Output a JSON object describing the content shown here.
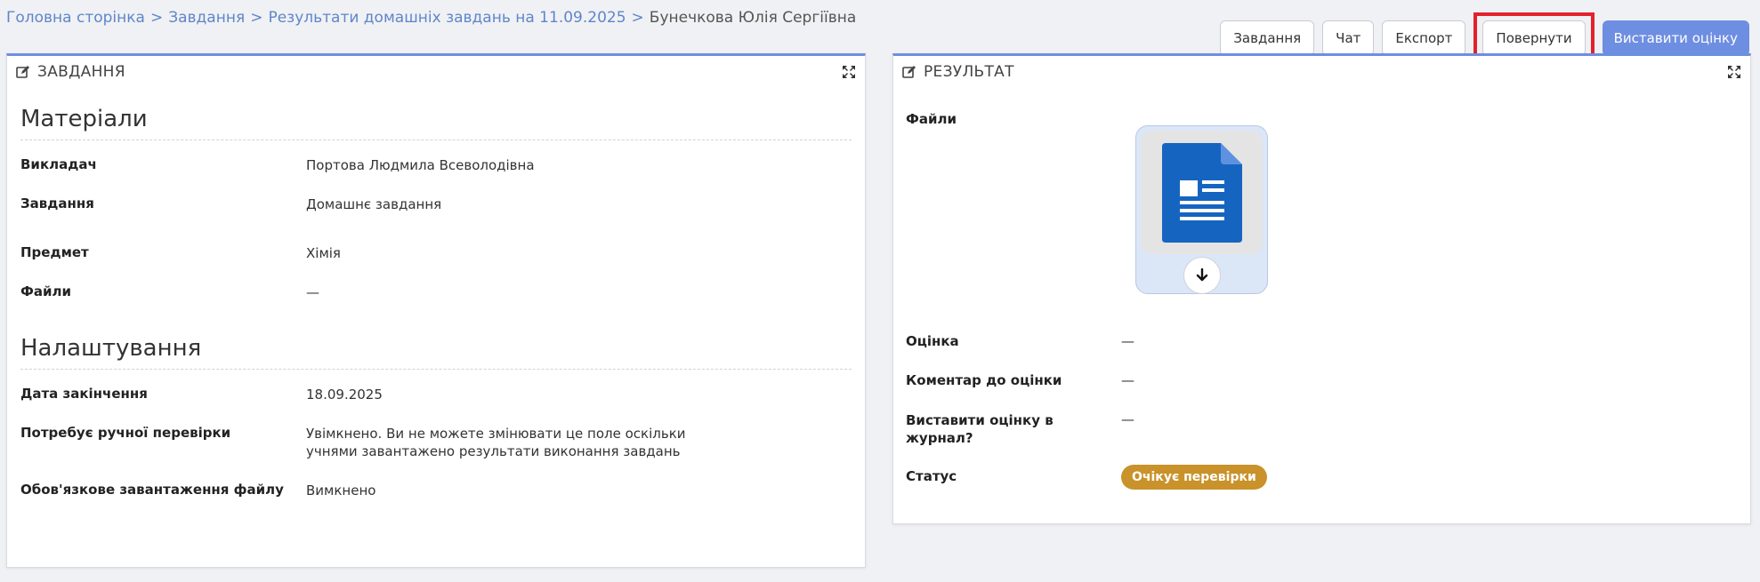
{
  "breadcrumb": {
    "items": [
      "Головна сторінка",
      "Завдання",
      "Результати домашніх завдань на 11.09.2025"
    ],
    "separator": ">",
    "current": "Бунечкова Юлія Сергіївна"
  },
  "toolbar": {
    "tasks_label": "Завдання",
    "chat_label": "Чат",
    "export_label": "Експорт",
    "return_label": "Повернути",
    "grade_label": "Виставити оцінку"
  },
  "task_panel": {
    "title": "ЗАВДАННЯ",
    "materials_title": "Матеріали",
    "teacher_label": "Викладач",
    "teacher_value": "Портова Людмила Всеволодівна",
    "task_label": "Завдання",
    "task_value": "Домашнє завдання",
    "subject_label": "Предмет",
    "subject_value": "Хімія",
    "files_label": "Файли",
    "files_value": "—",
    "settings_title": "Налаштування",
    "deadline_label": "Дата закінчення",
    "deadline_value": "18.09.2025",
    "manual_check_label": "Потребує ручної перевірки",
    "manual_check_value": "Увімкнено. Ви не можете змінювати це поле оскільки учнями завантажено результати виконання завдань",
    "required_upload_label": "Обов'язкове завантаження файлу",
    "required_upload_value": "Вимкнено"
  },
  "result_panel": {
    "title": "РЕЗУЛЬТАТ",
    "files_label": "Файли",
    "file_icon": "document-icon",
    "grade_label": "Оцінка",
    "grade_value": "—",
    "comment_label": "Коментар до оцінки",
    "comment_value": "—",
    "journal_label": "Виставити оцінку в журнал?",
    "journal_value": "—",
    "status_label": "Статус",
    "status_value": "Очікує перевірки"
  },
  "colors": {
    "accent": "#6e8ee2",
    "link": "#5f86c9",
    "status_pending": "#c9922a",
    "highlight": "#e3212b",
    "doc_blue": "#1565c0"
  }
}
